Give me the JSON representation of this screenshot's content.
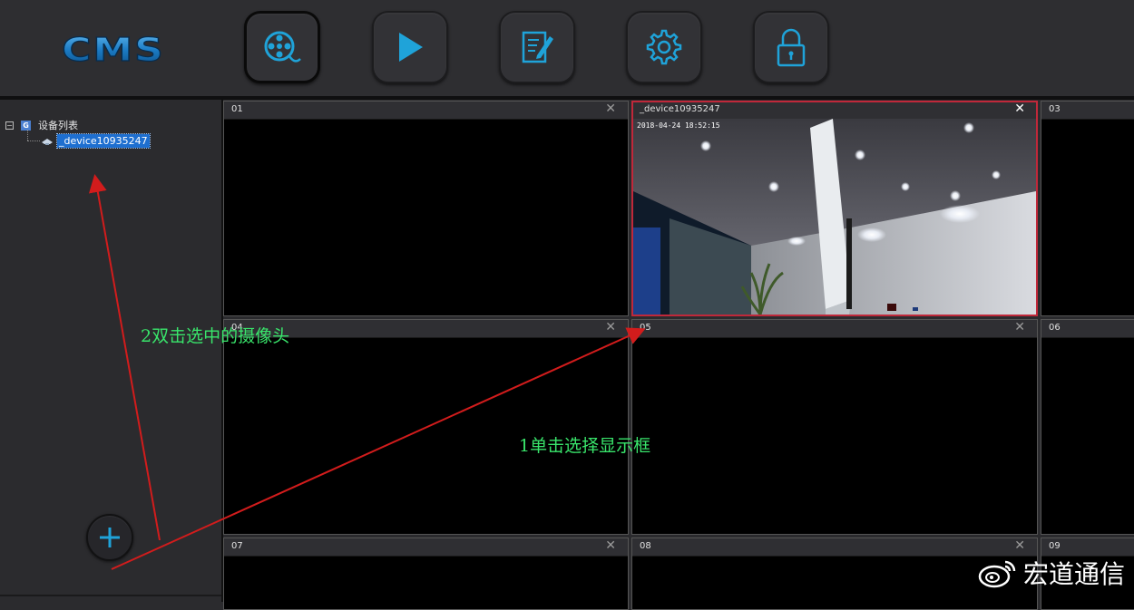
{
  "logo": {
    "text": "CMS"
  },
  "toolbar": {
    "buttons": [
      {
        "name": "live-view-button",
        "icon": "film-reel-icon"
      },
      {
        "name": "playback-button",
        "icon": "play-icon"
      },
      {
        "name": "log-button",
        "icon": "edit-document-icon"
      },
      {
        "name": "settings-button",
        "icon": "gear-icon"
      },
      {
        "name": "lock-button",
        "icon": "lock-icon"
      }
    ],
    "active_index": 0
  },
  "sidebar": {
    "tree": {
      "root_toggle": "−",
      "root_icon": "G",
      "root_label": "设备列表",
      "children": [
        {
          "label": "_device10935247",
          "icon": "camera-icon",
          "selected": true
        }
      ]
    },
    "add_button": {
      "icon": "plus-icon"
    }
  },
  "grid": {
    "cells": [
      {
        "label": "01",
        "has_video": false,
        "selected": false
      },
      {
        "label": "_device10935247",
        "has_video": true,
        "selected": true,
        "timestamp": "2018-04-24  18:52:15"
      },
      {
        "label": "03",
        "has_video": false,
        "selected": false
      },
      {
        "label": "04",
        "has_video": false,
        "selected": false
      },
      {
        "label": "05",
        "has_video": false,
        "selected": false
      },
      {
        "label": "06",
        "has_video": false,
        "selected": false
      },
      {
        "label": "07",
        "has_video": false,
        "selected": false
      },
      {
        "label": "08",
        "has_video": false,
        "selected": false
      },
      {
        "label": "09",
        "has_video": false,
        "selected": false
      }
    ],
    "close_glyph": "✕"
  },
  "annotations": {
    "step2": "2双击选中的摄像头",
    "step1": "1单击选择显示框"
  },
  "watermark": {
    "text": "宏道通信",
    "icon": "weibo-icon"
  },
  "colors": {
    "accent": "#1fa3d9",
    "selected_border": "#c0283a",
    "annotation_text": "#39e56b",
    "arrow": "#d21c1c"
  }
}
